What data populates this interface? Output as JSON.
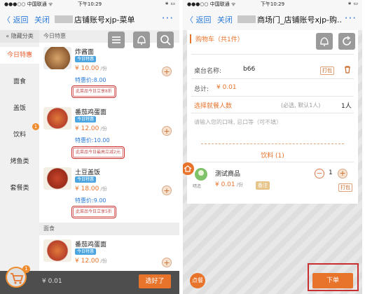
{
  "left": {
    "status": {
      "carrier": "●●●○○ 中国联通 ᯤ",
      "time": "下午10:29",
      "battery": "∗ ▭"
    },
    "nav": {
      "back": "〈 返回",
      "close": "关闭",
      "title": "店铺账号xjp-菜单",
      "more": "···"
    },
    "sidebar": {
      "hide": "« 隐藏分类",
      "items": [
        {
          "label": "今日特惠",
          "active": true
        },
        {
          "label": "面食"
        },
        {
          "label": "盖饭"
        },
        {
          "label": "饮料",
          "badge": "1"
        },
        {
          "label": "烤鱼类"
        },
        {
          "label": "套餐类"
        }
      ]
    },
    "section_today": "今日特惠",
    "section_noodle": "面食",
    "dishes": [
      {
        "name": "炸酱面",
        "tag": "今日特惠",
        "price": "¥ 10.00",
        "unit": "/份",
        "promo_label": "特惠价:",
        "promo_price": "8.00",
        "note": "此菜品今日立享8折"
      },
      {
        "name": "番茄鸡蛋面",
        "tag": "今日特惠",
        "price": "¥ 12.00",
        "unit": "/份",
        "promo_label": "特惠价:",
        "promo_price": "10.00",
        "note": "此菜品今日最高立减2元"
      },
      {
        "name": "土豆盖饭",
        "tag": "今日特惠",
        "price": "¥ 18.00",
        "unit": "/份",
        "promo_label": "特惠价:",
        "promo_price": "9.00",
        "note": "此菜品今日立享5折"
      },
      {
        "name": "番茄鸡蛋面",
        "tag": "今日特惠",
        "price": "¥ 12.00",
        "unit": "/份"
      }
    ],
    "bottom": {
      "cart_badge": "1",
      "total": "¥ 0.01",
      "select_done": "选好了"
    },
    "plus": "+"
  },
  "right": {
    "status": {
      "carrier": "●●●○○ 中国联通 ᯤ",
      "time": "下午10:29",
      "battery": "∗ ▭"
    },
    "nav": {
      "back": "〈 返回",
      "close": "关闭",
      "title": "商场门_店铺账号xjp-购...",
      "more": "···"
    },
    "cart_title": "购物车（共1件）",
    "table_label": "桌台名称:",
    "table_value": "b66",
    "pack_label": "打包",
    "total_label": "总计:",
    "total_value": "¥ 0.01",
    "diners_label": "选择就餐人数",
    "diners_hint": "(必选, 默认1人)",
    "diners_value": "1人",
    "taste_placeholder": "请输入您的口味, 忌口等（可不填）",
    "group_label": "饮料 (1)",
    "item": {
      "name": "测试商品",
      "price": "¥ 0.01",
      "unit": "/份",
      "remark": "备注",
      "qty": "1",
      "pack": "打包",
      "avatar_label": "晴造"
    },
    "minus": "−",
    "plus": "+",
    "home_label": "点餐",
    "order_button": "下单",
    "colors": {
      "accent": "#e8732a",
      "highlight": "#c83030"
    }
  }
}
